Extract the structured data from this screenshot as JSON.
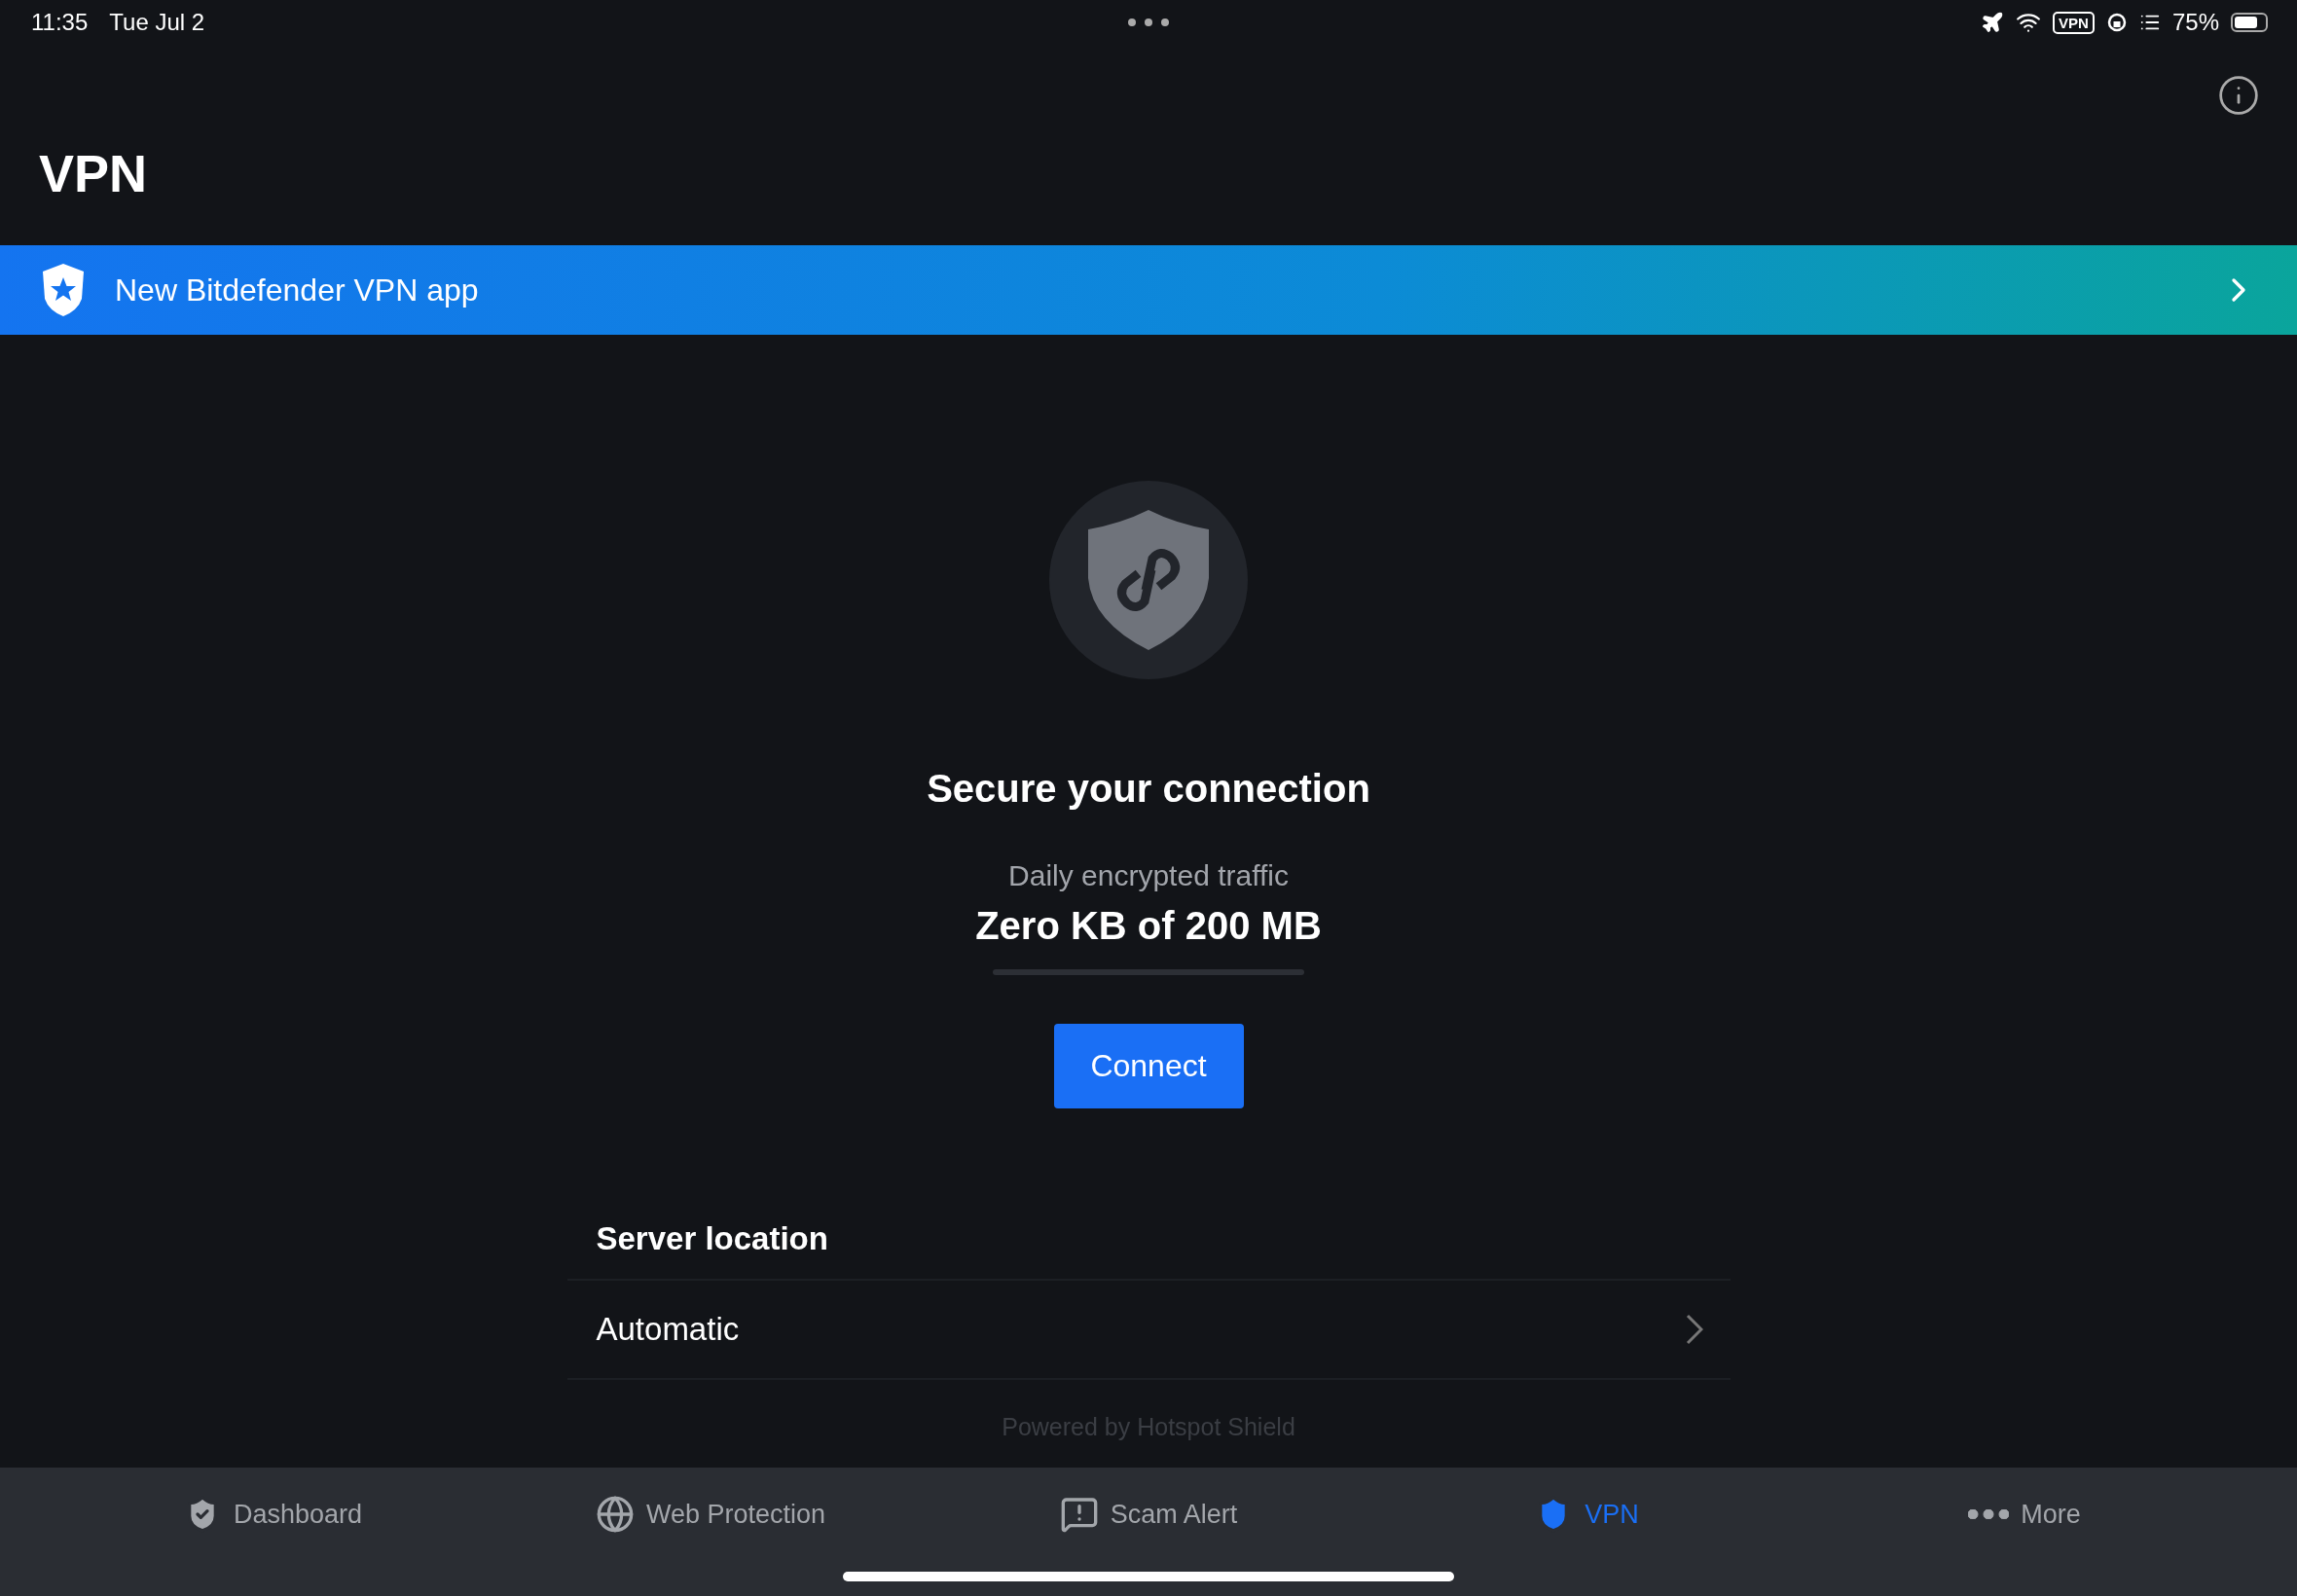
{
  "status_bar": {
    "time": "11:35",
    "date": "Tue Jul 2",
    "vpn_badge": "VPN",
    "battery_percent": "75%"
  },
  "header": {
    "title": "VPN"
  },
  "banner": {
    "label": "New Bitdefender VPN app"
  },
  "connection": {
    "heading": "Secure your connection",
    "traffic_label": "Daily encrypted traffic",
    "traffic_value": "Zero KB of 200 MB",
    "level": 0,
    "button": "Connect"
  },
  "server": {
    "heading": "Server location",
    "value": "Automatic"
  },
  "footer_note": "Powered by Hotspot Shield",
  "tabs": [
    {
      "label": "Dashboard",
      "selected": false
    },
    {
      "label": "Web Protection",
      "selected": false
    },
    {
      "label": "Scam Alert",
      "selected": false
    },
    {
      "label": "VPN",
      "selected": true
    },
    {
      "label": "More",
      "selected": false
    }
  ]
}
